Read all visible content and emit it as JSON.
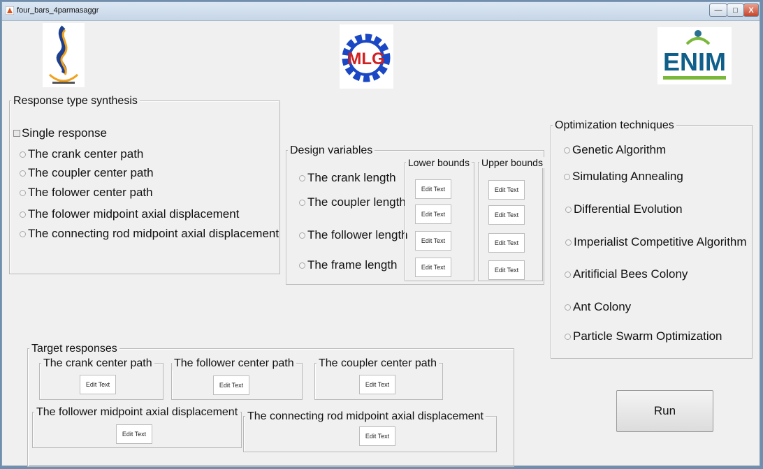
{
  "window": {
    "title": "four_bars_4parmasaggr",
    "min_label": "—",
    "max_label": "□",
    "close_label": "X"
  },
  "logos": {
    "center_letters": "MLG",
    "right_text": "ENIM"
  },
  "response_panel": {
    "title": "Response type synthesis",
    "single_response": "Single response",
    "options": [
      "The crank center path",
      "The coupler center path",
      "The folower center path",
      "The folower midpoint axial displacement",
      "The connecting rod midpoint axial displacement"
    ]
  },
  "design_panel": {
    "title": "Design variables",
    "lower_title": "Lower bounds",
    "upper_title": "Upper bounds",
    "variables": [
      "The crank length",
      "The coupler length",
      "The follower length",
      "The frame length"
    ],
    "edit_text": "Edit Text"
  },
  "optimization_panel": {
    "title": "Optimization techniques",
    "options": [
      "Genetic Algorithm",
      "Simulating Annealing",
      "Differential Evolution",
      "Imperialist Competitive Algorithm",
      "Aritificial Bees Colony",
      "Ant Colony",
      "Particle Swarm Optimization"
    ]
  },
  "target_panel": {
    "title": "Target responses",
    "crank": "The crank center path",
    "follower": "The follower center path",
    "coupler": "The coupler center path",
    "follower_mid": "The follower midpoint axial displacement",
    "rod_mid": "The connecting rod midpoint axial displacement",
    "edit_text": "Edit Text"
  },
  "run_label": "Run"
}
